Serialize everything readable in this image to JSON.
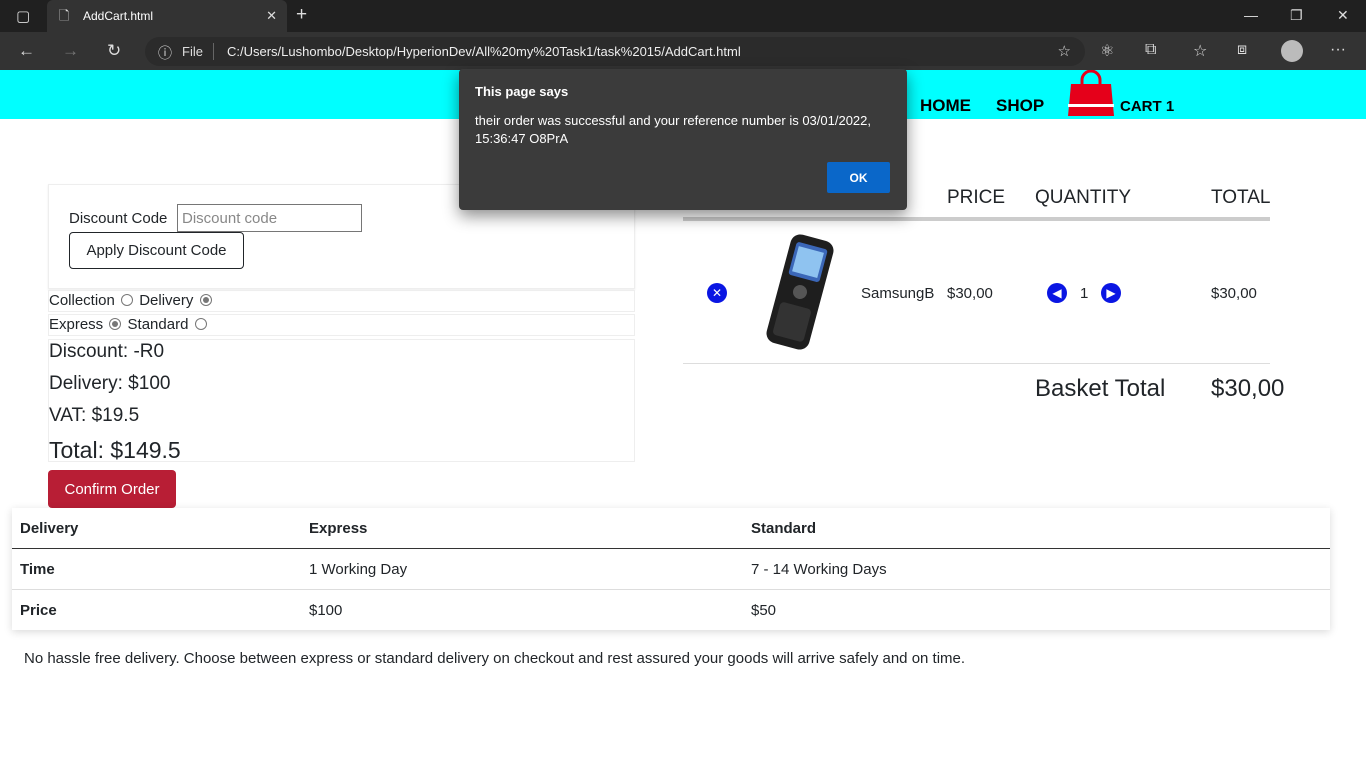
{
  "browser": {
    "tab_title": "AddCart.html",
    "file_label": "File",
    "url": "C:/Users/Lushombo/Desktop/HyperionDev/All%20my%20Task1/task%2015/AddCart.html"
  },
  "header": {
    "nav": [
      "HOME",
      "SHOP"
    ],
    "cart_label": "CART 1",
    "colors": {
      "bg": "#00ffff",
      "bag": "#e5001a"
    }
  },
  "discount": {
    "label": "Discount Code",
    "placeholder": "Discount code",
    "apply_label": "Apply Discount Code"
  },
  "options": {
    "collection": "Collection",
    "delivery": "Delivery",
    "express": "Express",
    "standard": "Standard",
    "selected_method": "Delivery",
    "selected_speed": "Express"
  },
  "summary": {
    "discount": "Discount: -R0",
    "delivery": "Delivery: $100",
    "vat": "VAT: $19.5",
    "total": "Total: $149.5"
  },
  "confirm_label": "Confirm Order",
  "cart": {
    "headers": [
      "PRICE",
      "QUANTITY",
      "TOTAL"
    ],
    "item": {
      "name": "SamsungB",
      "price": "$30,00",
      "qty": "1",
      "total": "$30,00"
    },
    "basket_total_label": "Basket Total",
    "basket_total": "$30,00"
  },
  "delivery_table": {
    "headers": [
      "Delivery",
      "Express",
      "Standard"
    ],
    "rows": [
      [
        "Time",
        "1 Working Day",
        "7 - 14 Working Days"
      ],
      [
        "Price",
        "$100",
        "$50"
      ]
    ]
  },
  "footnote": "No hassle free delivery. Choose between express or standard delivery on checkout and rest assured your goods will arrive safely and on time.",
  "dialog": {
    "title": "This page says",
    "message": "their order was successful and your reference number is 03/01/2022, 15:36:47 O8PrA",
    "ok": "OK"
  }
}
